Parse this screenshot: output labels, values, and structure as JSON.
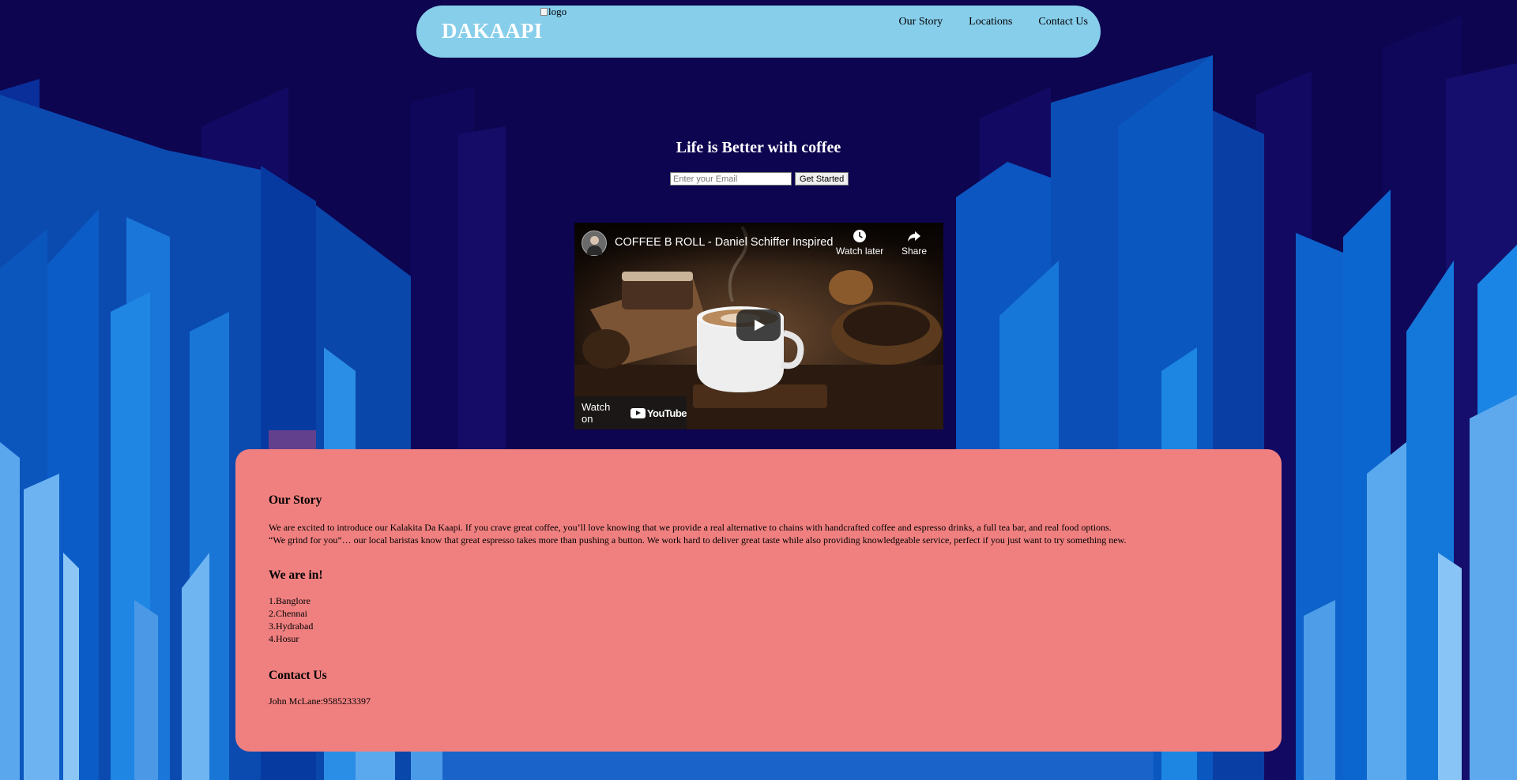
{
  "nav": {
    "brand": "DAKAAPI",
    "logo_alt": "logo",
    "links": [
      "Our Story",
      "Locations",
      "Contact Us"
    ]
  },
  "hero": {
    "title": "Life is Better with coffee",
    "email_placeholder": "Enter your Email",
    "button": "Get Started"
  },
  "video": {
    "title": "COFFEE B ROLL - Daniel Schiffer Inspired",
    "watch_later": "Watch later",
    "share": "Share",
    "watch_on": "Watch on",
    "youtube": "YouTube"
  },
  "story": {
    "heading": "Our Story",
    "line1": "We are excited to introduce our Kalakita Da Kaapi. If you crave great coffee, you’ll love knowing that we provide a real alternative to chains with handcrafted coffee and espresso drinks, a full tea bar, and real food options.",
    "line2": "“We grind for you”… our local baristas know that great espresso takes more than pushing a button. We work hard to deliver great taste while also providing knowledgeable service, perfect if you just want to try something new."
  },
  "locations": {
    "heading": "We are in!",
    "cities": [
      "1.Banglore",
      "2.Chennai",
      "3.Hydrabad",
      "4.Hosur"
    ]
  },
  "contact": {
    "heading": "Contact Us",
    "entry": "John McLane:9585233397"
  },
  "colors": {
    "nav_bg": "#87ceeb",
    "panel_bg": "#f08080",
    "page_bg": "#0d0550"
  },
  "icons": [
    "clock-icon",
    "share-icon",
    "play-icon",
    "youtube-logo-icon"
  ]
}
